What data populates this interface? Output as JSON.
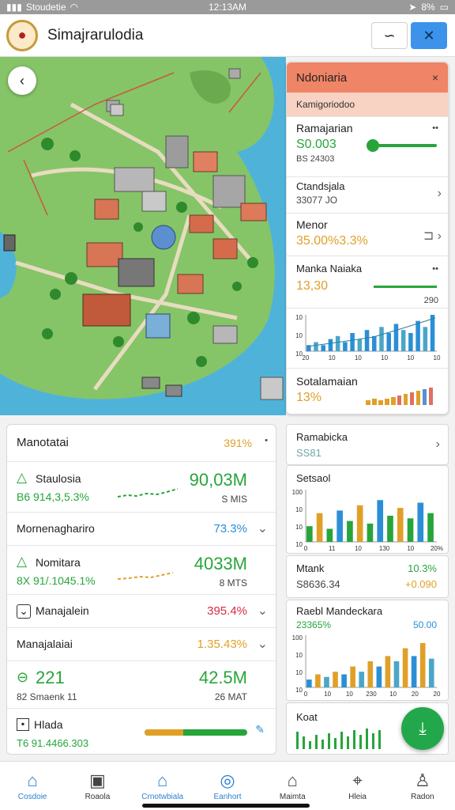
{
  "status": {
    "carrier": "Stoudetie",
    "time": "12:13AM",
    "battery": "8%"
  },
  "app": {
    "title": "Simajrarulodia"
  },
  "right_panel": {
    "header": "Ndoniaria",
    "subheader": "Kamigoriodoo",
    "item1": {
      "label": "Ramajarian",
      "value": "S0.003",
      "sub": "BS 24303",
      "slider": 0.1
    },
    "item2": {
      "label": "Ctandsjala",
      "value": "33077 JO"
    },
    "item3": {
      "label": "Menor",
      "value": "35.00%3.3%"
    },
    "item4": {
      "label": "Manka Naiaka",
      "value": "13,30",
      "sub": "290"
    },
    "chart1": {
      "ticks_y": [
        "10",
        "10",
        "10"
      ],
      "ticks_x": [
        "20",
        "10",
        "10",
        "10",
        "10",
        "10"
      ]
    },
    "item5": {
      "label": "Sotalamaian",
      "value": "13%"
    }
  },
  "left_card": {
    "header": {
      "label": "Manotatai",
      "value": "391%"
    },
    "row1": {
      "label": "Staulosia",
      "value": "90,03M",
      "sub_left": "B6 914,3,5.3%",
      "sub_right": "S MIS"
    },
    "row2": {
      "label": "Mornenaghariro",
      "value": "73.3%"
    },
    "row3": {
      "label": "Nomitara",
      "value": "4033M",
      "sub_left": "8X 91/.1045.1%",
      "sub_right": "8 MTS"
    },
    "row4": {
      "label": "Manajalein",
      "value": "395.4%"
    },
    "row5": {
      "label": "Manajalaiai",
      "value": "1.35.43%"
    },
    "row6": {
      "label": "221",
      "value": "42.5M",
      "sub_left": "82 Smaenk 11",
      "sub_right": "26 MAT"
    },
    "row7": {
      "label": "Hlada",
      "sub_left": "T6 91.4466.303"
    }
  },
  "right_cards": {
    "card1": {
      "label": "Ramabicka",
      "sub": "SS81"
    },
    "card2": {
      "label": "Setsaol",
      "ticks_y": [
        "100",
        "10",
        "10",
        "10"
      ],
      "ticks_x": [
        "0",
        "11",
        "10",
        "130",
        "10",
        "20%"
      ]
    },
    "card3": {
      "label": "Mtank",
      "sub": "S8636.34",
      "value": "10.3%",
      "value2": "+0.090"
    },
    "card4": {
      "label": "Raebl Mandeckara",
      "value": "23365%",
      "value2": "50.00",
      "ticks_y": [
        "100",
        "10",
        "10",
        "10"
      ],
      "ticks_x": [
        "0",
        "10",
        "10",
        "230",
        "10",
        "20",
        "20"
      ]
    },
    "card5": {
      "label": "Koat"
    }
  },
  "chart_data": [
    {
      "type": "bar",
      "name_ref": "right_panel.chart1",
      "values": [
        2,
        3,
        2,
        4,
        5,
        3,
        6,
        4,
        7,
        5,
        8,
        6,
        9,
        7,
        6,
        10,
        8,
        12
      ],
      "ylim": [
        0,
        12
      ]
    },
    {
      "type": "bar",
      "name_ref": "card2",
      "values": [
        30,
        55,
        25,
        60,
        40,
        70,
        35,
        80,
        50,
        65,
        45,
        75,
        55
      ],
      "ylim": [
        0,
        100
      ]
    },
    {
      "type": "bar",
      "name_ref": "card4",
      "values": [
        15,
        25,
        20,
        30,
        25,
        40,
        30,
        50,
        40,
        60,
        50,
        75,
        60,
        85,
        55
      ],
      "ylim": [
        0,
        100
      ]
    }
  ],
  "nav": [
    {
      "label": "Cosdoie",
      "icon": "home-icon",
      "active": true
    },
    {
      "label": "Roaola",
      "icon": "calculator-icon"
    },
    {
      "label": "Crnotwbiala",
      "icon": "house-icon",
      "active": true
    },
    {
      "label": "Eanhort",
      "icon": "circle-icon",
      "active": true
    },
    {
      "label": "Maimta",
      "icon": "building-icon"
    },
    {
      "label": "Hleia",
      "icon": "map-icon"
    },
    {
      "label": "Radon",
      "icon": "user-icon"
    }
  ],
  "colors": {
    "green": "#27a53b",
    "orange": "#e0a028",
    "blue": "#2b8fd6",
    "red": "#d92a45",
    "header": "#f08466"
  }
}
